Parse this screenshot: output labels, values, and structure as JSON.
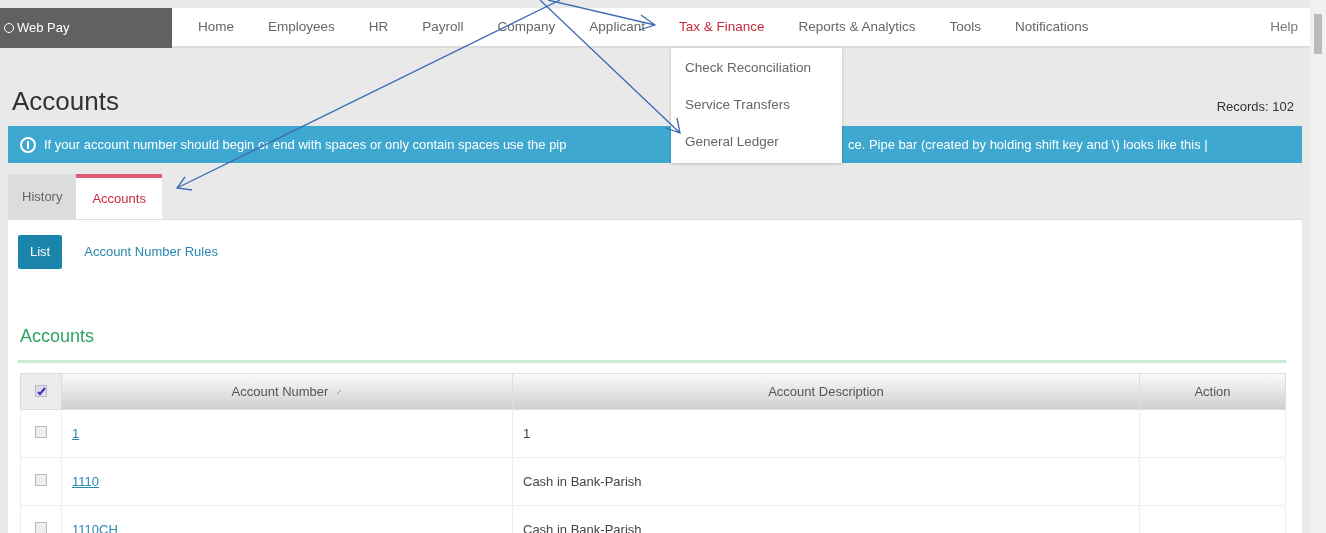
{
  "logo": {
    "text": "Web Pay"
  },
  "nav": [
    {
      "label": "Home",
      "selected": false
    },
    {
      "label": "Employees",
      "selected": false
    },
    {
      "label": "HR",
      "selected": false
    },
    {
      "label": "Payroll",
      "selected": false
    },
    {
      "label": "Company",
      "selected": false
    },
    {
      "label": "Applicant",
      "selected": false
    },
    {
      "label": "Tax & Finance",
      "selected": true
    },
    {
      "label": "Reports & Analytics",
      "selected": false
    },
    {
      "label": "Tools",
      "selected": false
    },
    {
      "label": "Notifications",
      "selected": false
    }
  ],
  "help": "Help",
  "dropdown": [
    "Check Reconciliation",
    "Service Transfers",
    "General Ledger"
  ],
  "page_title": "Accounts",
  "records": "Records: 102",
  "banner": {
    "before": "If your account number should begin or end with spaces or only contain spaces use the pip",
    "after": "ce. Pipe bar (created by holding shift key and \\) looks like this |"
  },
  "tabs": [
    {
      "label": "History",
      "selected": false
    },
    {
      "label": "Accounts",
      "selected": true
    }
  ],
  "subnav": [
    {
      "label": "List",
      "selected": true
    },
    {
      "label": "Account Number Rules",
      "selected": false
    }
  ],
  "section_title": "Accounts",
  "table": {
    "select_all": {
      "checked": true
    },
    "columns": [
      "Account Number",
      "Account Description",
      "Action"
    ],
    "rows": [
      {
        "checked": false,
        "number": "1",
        "description": "1"
      },
      {
        "checked": false,
        "number": "1110",
        "description": "Cash in Bank-Parish"
      },
      {
        "checked": false,
        "number": "1110CH",
        "description": "Cash in Bank-Parish"
      }
    ]
  }
}
